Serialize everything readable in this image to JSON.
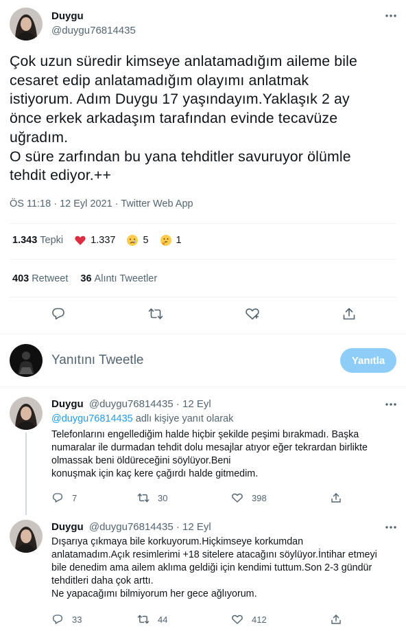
{
  "main_tweet": {
    "name": "Duygu",
    "handle": "@duygu76814435",
    "text": "Çok uzun süredir kimseye anlatamadığım aileme bile\ncesaret edip anlatamadığım olayımı anlatmak\nistiyorum. Adım Duygu 17 yaşındayım.Yaklaşık 2 ay\nönce erkek arkadaşım tarafından evinde tecavüze\nuğradım.\nO süre zarfından bu yana tehditler savuruyor ölümle\ntehdit ediyor.++",
    "meta": "ÖS 11:18 · 12 Eyl 2021 · Twitter Web App"
  },
  "reactions": {
    "total": "1.343",
    "total_label": "Tepki",
    "heart": "1.337",
    "cry": "5",
    "think": "1"
  },
  "retweets": {
    "retweet_count": "403",
    "retweet_label": "Retweet",
    "quote_count": "36",
    "quote_label": "Alıntı Tweetler"
  },
  "compose": {
    "placeholder": "Yanıtını Tweetle",
    "button": "Yanıtla"
  },
  "replies": [
    {
      "name": "Duygu",
      "handle": "@duygu76814435",
      "date": "· 12 Eyl",
      "reply_to_link": "@duygu76814435",
      "reply_to_suffix": " adlı kişiye yanıt olarak",
      "text": "Telefonlarını engellediğim halde hiçbir şekilde peşimi bırakmadı. Başka\nnumaralar ile durmadan tehdit dolu mesajlar atıyor eğer tekrardan birlikte\nolmassak beni öldüreceğini söylüyor.Beni\nkonuşmak için kaç kere çağırdı halde gitmedim.",
      "replies": "7",
      "retweets": "30",
      "likes": "398"
    },
    {
      "name": "Duygu",
      "handle": "@duygu76814435",
      "date": "· 12 Eyl",
      "text": "Dışarıya çıkmaya bile korkuyorum.Hiçkimseye korkumdan\nanlatamadım.Açık resimlerimi +18 sitelere atacağını söylüyor.İntihar etmeyi\nbile denedim ama ailem aklıma geldiği için kendimi tuttum.Son 2-3 gündür\ntehditleri daha çok arttı.\nNe yapacağımı bilmiyorum her gece ağlıyorum.",
      "replies": "33",
      "retweets": "44",
      "likes": "412"
    }
  ],
  "colors": {
    "text": "#0f1419",
    "secondary": "#536471",
    "accent": "#1d9bf0",
    "button_disabled": "#8ecdf8",
    "divider": "#eff3f4"
  },
  "icons": [
    "more-icon",
    "reply-icon",
    "retweet-icon",
    "like-icon",
    "share-icon",
    "heart-emoji-icon",
    "crying-emoji-icon",
    "thinking-emoji-icon"
  ]
}
